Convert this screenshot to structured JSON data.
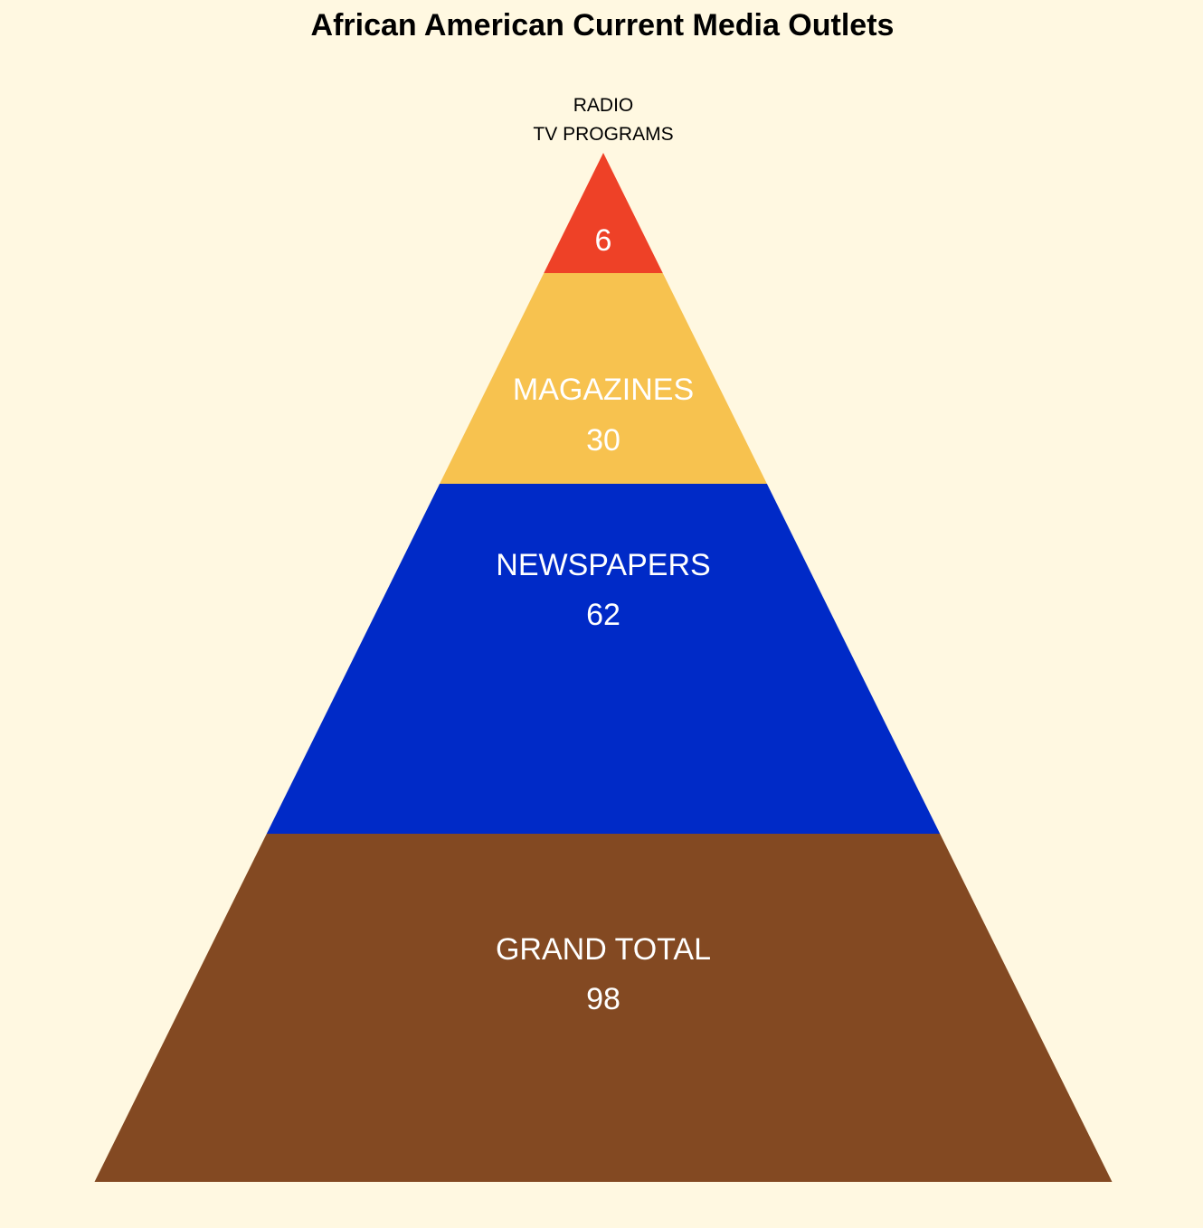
{
  "chart_data": {
    "type": "pyramid",
    "title": "African American Current Media Outlets",
    "levels": [
      {
        "label": "RADIO",
        "value": null,
        "color": "",
        "label_color": "#000000"
      },
      {
        "label": "TV PROGRAMS",
        "value": 6,
        "color": "#ee4127",
        "label_color": "#000000",
        "value_color": "#ffffff"
      },
      {
        "label": "MAGAZINES",
        "value": 30,
        "color": "#f7c24f",
        "label_color": "#ffffff",
        "value_color": "#ffffff"
      },
      {
        "label": "NEWSPAPERS",
        "value": 62,
        "color": "#002ac7",
        "label_color": "#ffffff",
        "value_color": "#ffffff"
      },
      {
        "label": "GRAND TOTAL",
        "value": 98,
        "color": "#834922",
        "label_color": "#ffffff",
        "value_color": "#ffffff"
      }
    ],
    "background": "#fff8e1"
  }
}
